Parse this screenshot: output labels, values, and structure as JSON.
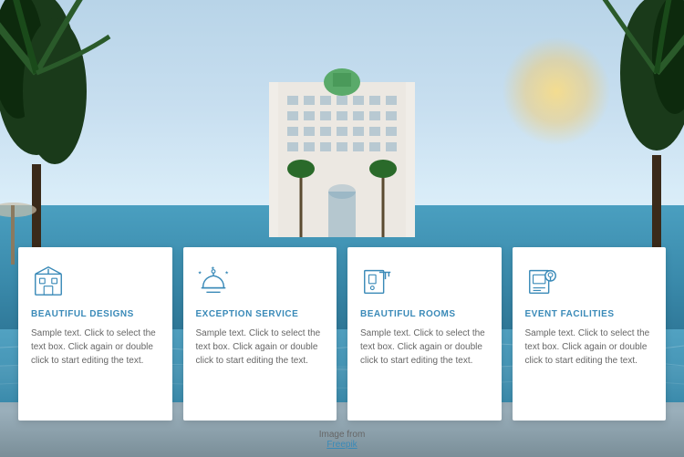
{
  "scene": {
    "attribution": {
      "line1": "Image from",
      "line2": "Freepik"
    }
  },
  "cards": [
    {
      "id": "beautiful-designs",
      "icon": "building-icon",
      "title": "BEAUTIFUL DESIGNS",
      "text": "Sample text. Click to select the text box. Click again or double click to start editing the text."
    },
    {
      "id": "exception-service",
      "icon": "service-icon",
      "title": "EXCEPTION SERVICE",
      "text": "Sample text. Click to select the text box. Click again or double click to start editing the text."
    },
    {
      "id": "beautiful-rooms",
      "icon": "room-icon",
      "title": "BEAUTIFUL ROOMS",
      "text": "Sample text. Click to select the text box. Click again or double click to start editing the text."
    },
    {
      "id": "event-facilities",
      "icon": "event-icon",
      "title": "EVENT FACILITIES",
      "text": "Sample text. Click to select the text box. Click again or double click to start editing the text."
    }
  ]
}
